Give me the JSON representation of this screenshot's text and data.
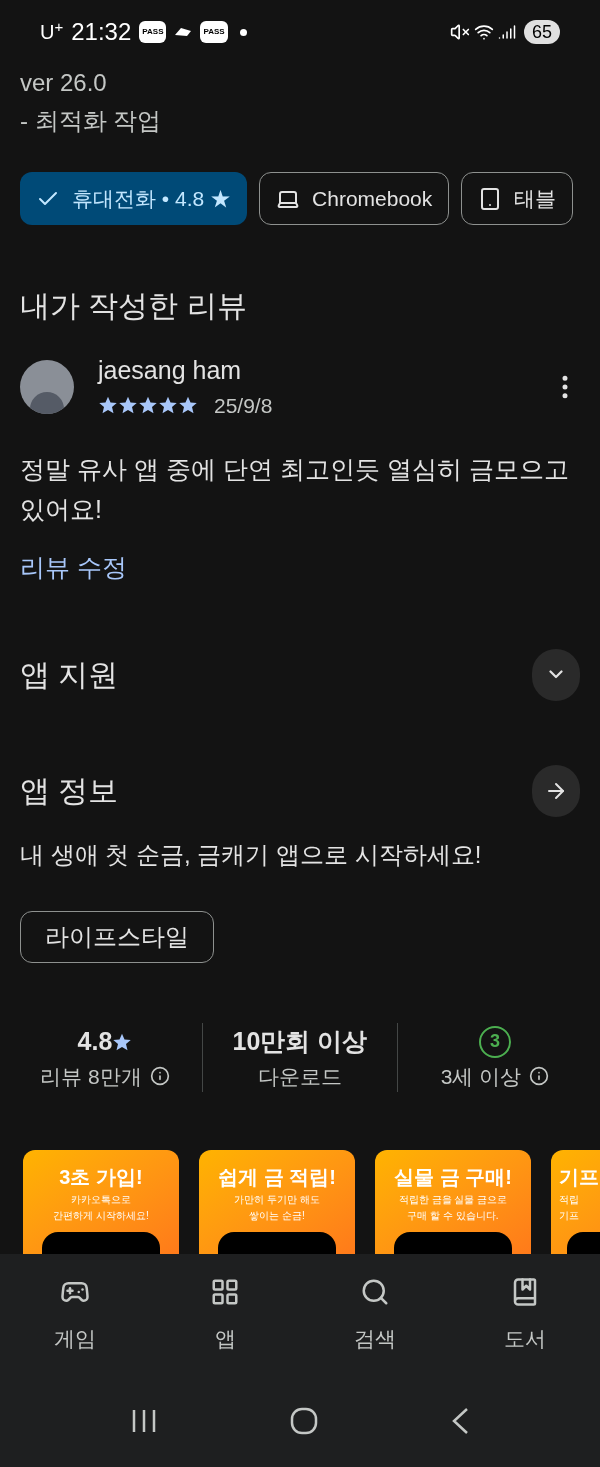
{
  "status_bar": {
    "carrier": "U$^{+}$",
    "time": "21:32",
    "badges": [
      "PASS",
      "PASS"
    ],
    "battery": "65"
  },
  "whats_new": [
    "ver 26.0",
    "- 최적화 작업"
  ],
  "devices": [
    {
      "label": "휴대전화 • 4.8 ★",
      "selected": true
    },
    {
      "label": "Chromebook",
      "selected": false
    },
    {
      "label": "태블",
      "selected": false
    }
  ],
  "my_review": {
    "heading": "내가 작성한 리뷰",
    "author": "jaesang ham",
    "stars": 5,
    "date": "25/9/8",
    "text": "정말 유사 앱 중에 단연 최고인듯 열심히 금모으고 있어요!",
    "edit_link": "리뷰 수정"
  },
  "sections": [
    {
      "title": "앱 지원",
      "kind": "expand"
    },
    {
      "title": "앱 정보",
      "kind": "arrow"
    }
  ],
  "description": "내 생애 첫 순금, 금캐기 앱으로 시작하세요!",
  "category": "라이프스타일",
  "stats": [
    {
      "kind": "rating",
      "value": "4.8",
      "label": "리뷰 8만개"
    },
    {
      "kind": "text",
      "value": "10만회 이상",
      "label": "다운로드"
    },
    {
      "kind": "age",
      "value": "3",
      "label": "3세 이상"
    }
  ],
  "screenshots": [
    {
      "headline": "3초 가입!",
      "lines": [
        "카카오톡으로",
        "간편하게 시작하세요!"
      ]
    },
    {
      "headline": "쉽게 금 적립!",
      "lines": [
        "가만히 두기만 해도",
        "쌓이는 순금!"
      ]
    },
    {
      "headline": "실물 금 구매!",
      "lines": [
        "적립한 금을 실물 금으로",
        "구매 할 수 있습니다."
      ]
    },
    {
      "headline": "기프",
      "lines": [
        "적립",
        "기프"
      ]
    }
  ],
  "bottom_nav": [
    {
      "label": "게임"
    },
    {
      "label": "앱"
    },
    {
      "label": "검색"
    },
    {
      "label": "도서"
    }
  ]
}
